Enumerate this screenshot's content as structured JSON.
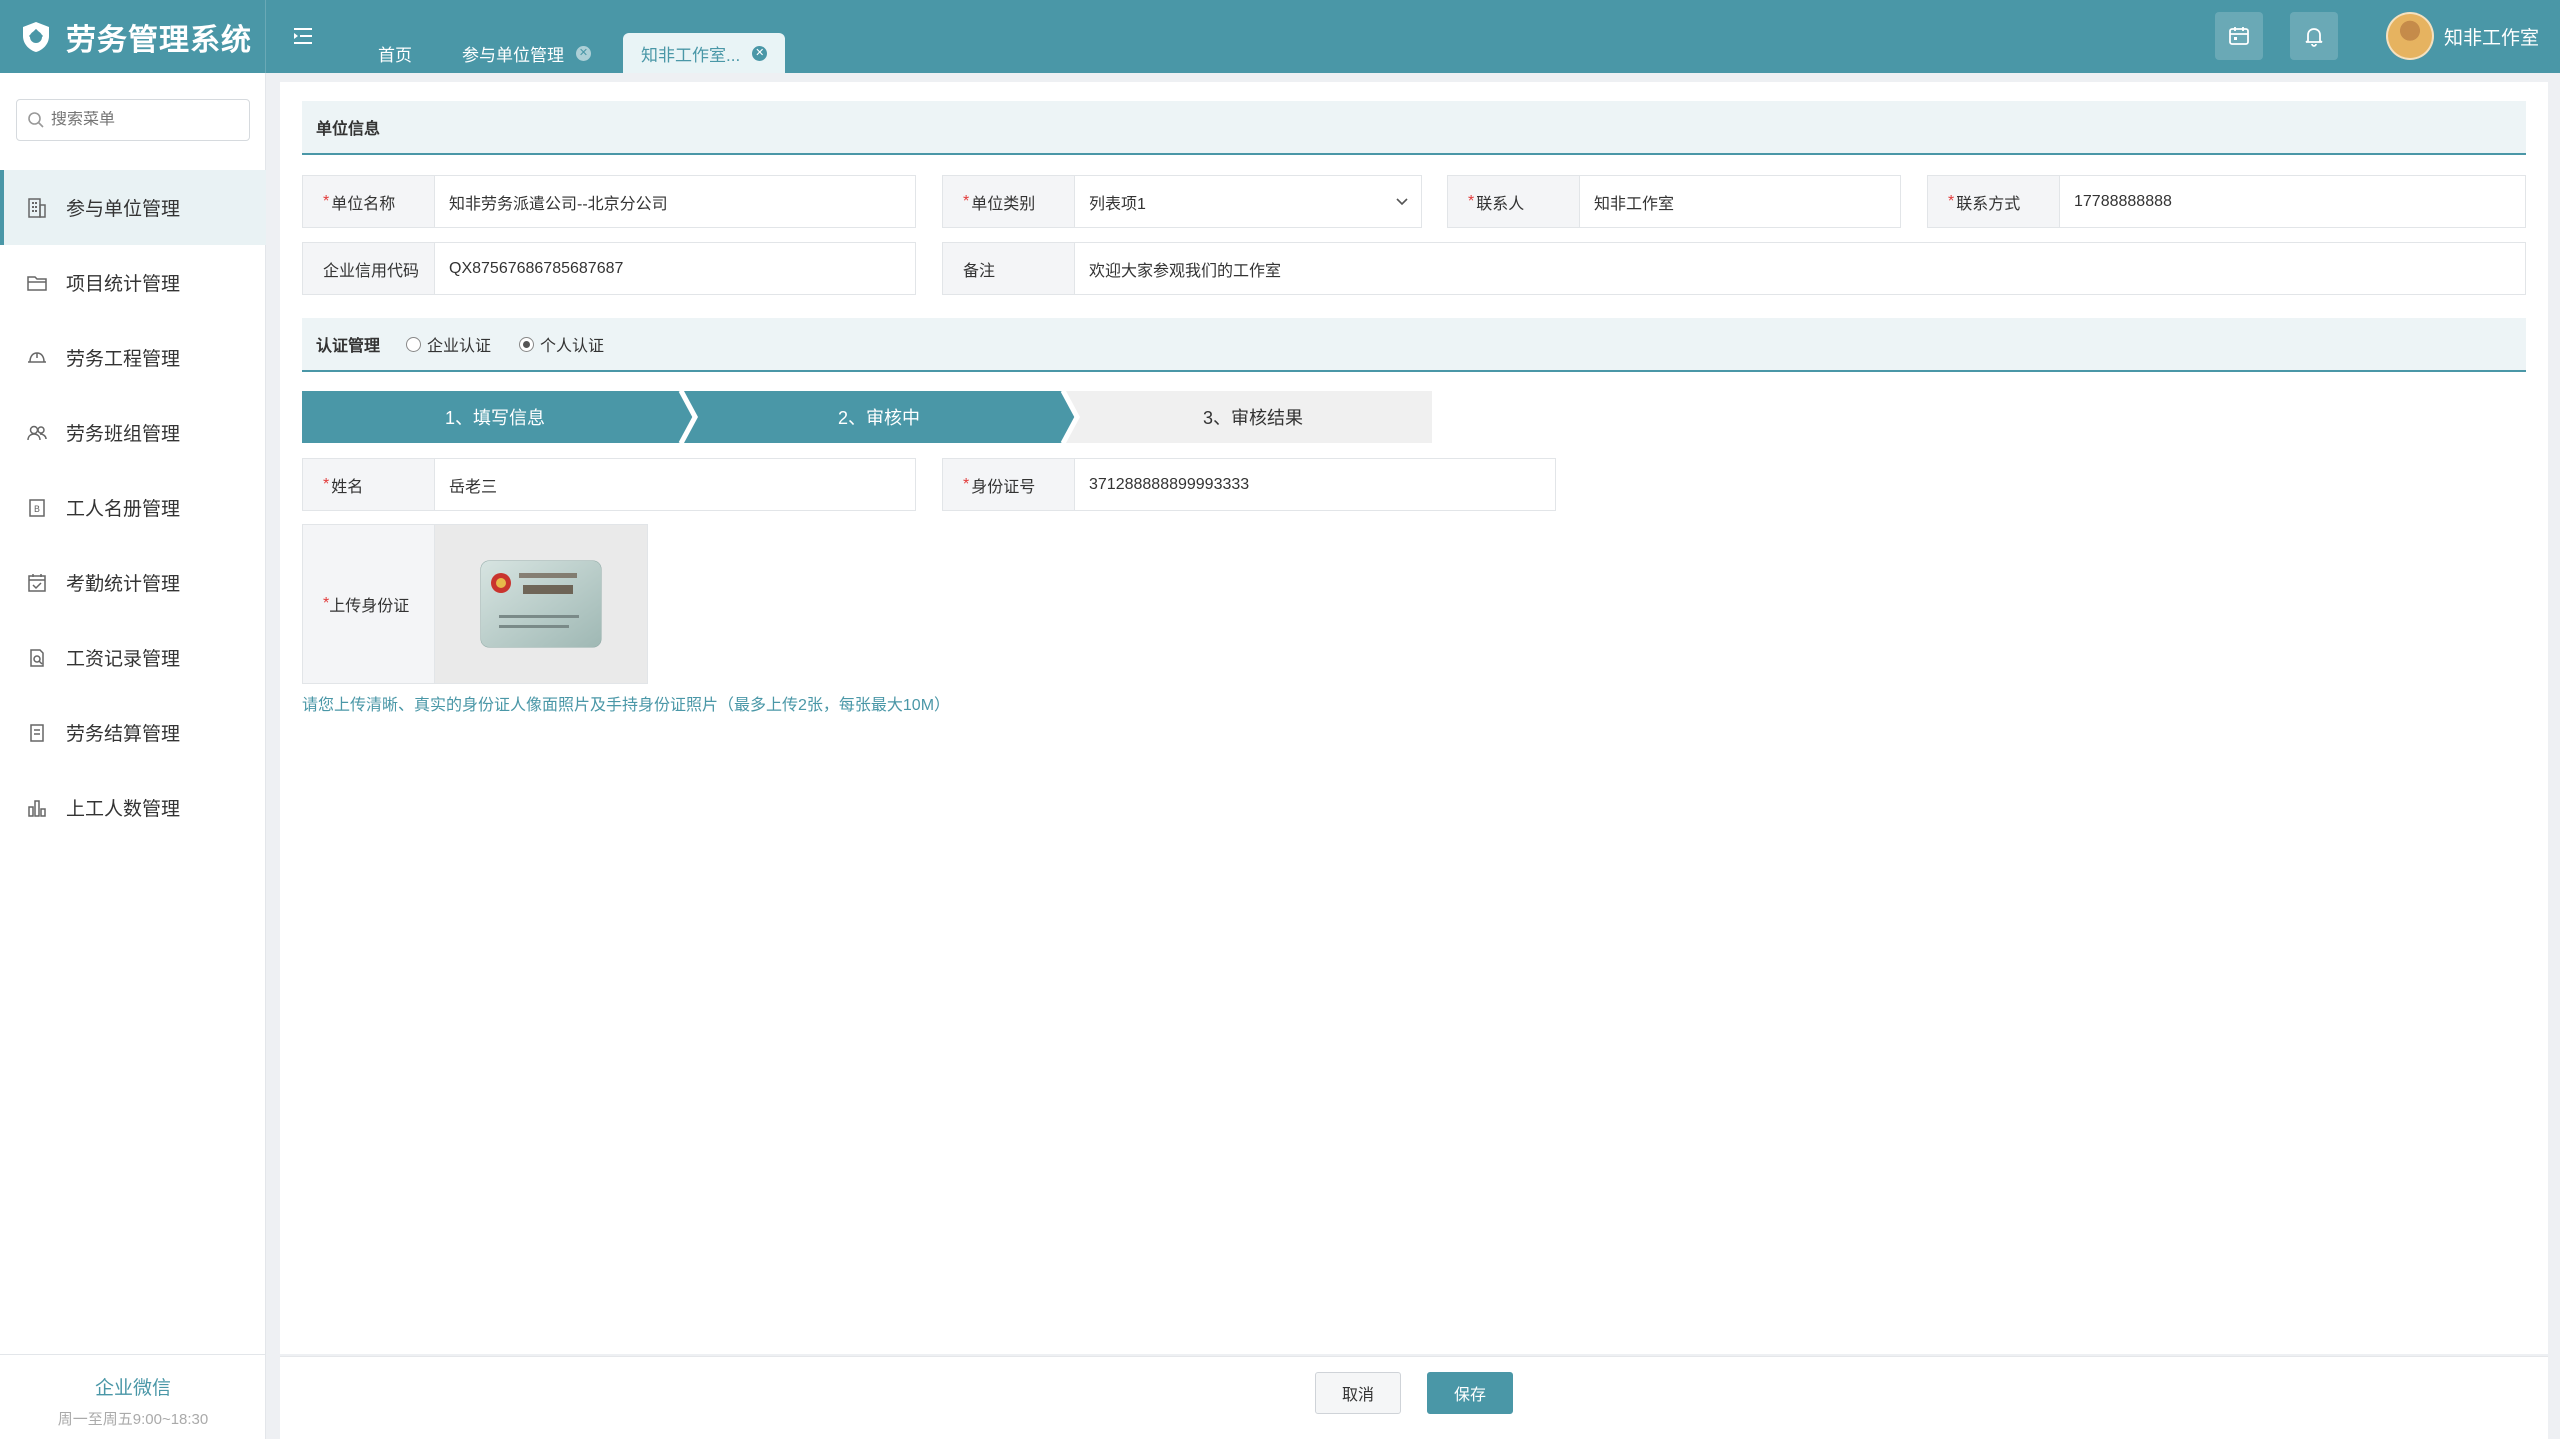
{
  "app": {
    "title": "劳务管理系统"
  },
  "header": {
    "tabs": [
      {
        "label": "首页"
      },
      {
        "label": "参与单位管理"
      },
      {
        "label": "知非工作室..."
      }
    ],
    "user_name": "知非工作室"
  },
  "sidebar": {
    "search_placeholder": "搜索菜单",
    "items": [
      {
        "label": "参与单位管理",
        "icon": "building-icon"
      },
      {
        "label": "项目统计管理",
        "icon": "folder-icon"
      },
      {
        "label": "劳务工程管理",
        "icon": "hardhat-icon"
      },
      {
        "label": "劳务班组管理",
        "icon": "team-icon"
      },
      {
        "label": "工人名册管理",
        "icon": "roster-icon"
      },
      {
        "label": "考勤统计管理",
        "icon": "calendar-check-icon"
      },
      {
        "label": "工资记录管理",
        "icon": "salary-doc-icon"
      },
      {
        "label": "劳务结算管理",
        "icon": "document-icon"
      },
      {
        "label": "上工人数管理",
        "icon": "bar-chart-icon"
      }
    ],
    "footer_title": "企业微信",
    "footer_hours": "周一至周五9:00~18:30"
  },
  "unit_info": {
    "section_title": "单位信息",
    "name_label": "单位名称",
    "name_value": "知非劳务派遣公司--北京分公司",
    "category_label": "单位类别",
    "category_value": "列表项1",
    "contact_label": "联系人",
    "contact_value": "知非工作室",
    "phone_label": "联系方式",
    "phone_value": "17788888888",
    "credit_label": "企业信用代码",
    "credit_value": "QX87567686785687687",
    "remark_label": "备注",
    "remark_value": "欢迎大家参观我们的工作室"
  },
  "auth": {
    "section_title": "认证管理",
    "option_company": "企业认证",
    "option_personal": "个人认证",
    "steps": [
      "1、填写信息",
      "2、审核中",
      "3、审核结果"
    ],
    "person_name_label": "姓名",
    "person_name_value": "岳老三",
    "id_label": "身份证号",
    "id_value": "371288888899993333",
    "upload_label": "上传身份证",
    "upload_hint": "请您上传清晰、真实的身份证人像面照片及手持身份证照片（最多上传2张，每张最大10M）"
  },
  "footer": {
    "cancel_label": "取消",
    "save_label": "保存"
  },
  "colors": {
    "primary": "#4a97a7",
    "required": "#e23b3b",
    "step_inactive": "#f0f0f0"
  }
}
